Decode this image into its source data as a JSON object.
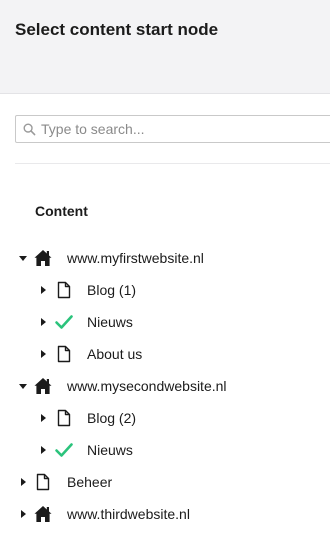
{
  "dialog": {
    "title": "Select content start node"
  },
  "search": {
    "placeholder": "Type to search..."
  },
  "tree": {
    "section_label": "Content",
    "rows": [
      {
        "label": "www.myfirstwebsite.nl",
        "icon": "home-icon",
        "expanded": true
      },
      {
        "label": "Blog (1)",
        "icon": "document-icon",
        "expanded": false
      },
      {
        "label": "Nieuws",
        "icon": "check-icon",
        "expanded": false
      },
      {
        "label": "About us",
        "icon": "document-icon",
        "expanded": false
      },
      {
        "label": "www.mysecondwebsite.nl",
        "icon": "home-icon",
        "expanded": true
      },
      {
        "label": "Blog (2)",
        "icon": "document-icon",
        "expanded": false
      },
      {
        "label": "Nieuws",
        "icon": "check-icon",
        "expanded": false
      },
      {
        "label": "Beheer",
        "icon": "document-icon",
        "expanded": false
      },
      {
        "label": "www.thirdwebsite.nl",
        "icon": "home-icon",
        "expanded": false
      }
    ]
  },
  "colors": {
    "check": "#2bc37c",
    "header_bg": "#f3f3f5",
    "text": "#1b1b1b"
  }
}
